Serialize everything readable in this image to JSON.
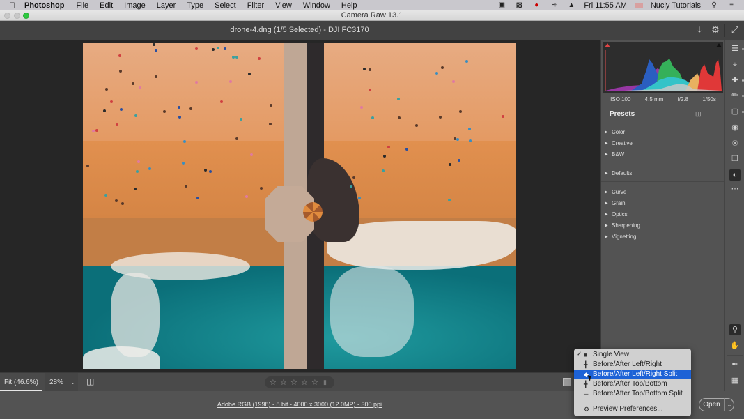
{
  "menubar": {
    "app_name": "Photoshop",
    "items": [
      "File",
      "Edit",
      "Image",
      "Layer",
      "Type",
      "Select",
      "Filter",
      "View",
      "Window",
      "Help"
    ],
    "status_icons": [
      "camera-icon",
      "display-icon",
      "screen-record-icon",
      "wifi-icon",
      "airplay-icon"
    ],
    "clock": "Fri 11:55 AM",
    "user": "Nucly Tutorials"
  },
  "window": {
    "title": "Camera Raw 13.1"
  },
  "header": {
    "file_title": "drone-4.dng (1/5 Selected)  -  DJI FC3170"
  },
  "photo": {
    "subject": "aerial beach pier",
    "view_mode": "Before/After Left/Right Split"
  },
  "histogram": {
    "exif": {
      "iso": "ISO 100",
      "focal_length": "4.5 mm",
      "aperture": "f/2.8",
      "shutter": "1/50s"
    }
  },
  "presets_panel": {
    "title": "Presets",
    "groups": [
      [
        "Color",
        "Creative",
        "B&W"
      ],
      [
        "Defaults"
      ],
      [
        "Curve",
        "Grain",
        "Optics",
        "Sharpening",
        "Vignetting"
      ]
    ]
  },
  "bottombar": {
    "zoom_fit": "Fit (46.6%)",
    "zoom_pct": "28%",
    "rating_stars": 0,
    "rating_max": 5
  },
  "statusbar": {
    "info": "Adobe RGB (1998) - 8 bit - 4000 x 3000 (12.0MP) - 300 ppi",
    "open_label": "Open"
  },
  "view_menu": {
    "items": [
      {
        "label": "Single View",
        "checked": true,
        "selected": false
      },
      {
        "label": "Before/After Left/Right",
        "checked": false,
        "selected": false
      },
      {
        "label": "Before/After Left/Right Split",
        "checked": false,
        "selected": true
      },
      {
        "label": "Before/After Top/Bottom",
        "checked": false,
        "selected": false
      },
      {
        "label": "Before/After Top/Bottom Split",
        "checked": false,
        "selected": false
      }
    ],
    "footer": "Preview Preferences..."
  },
  "colors": {
    "menu_highlight": "#1d62d6",
    "panel_bg": "#535353",
    "canvas_bg": "#262626"
  }
}
